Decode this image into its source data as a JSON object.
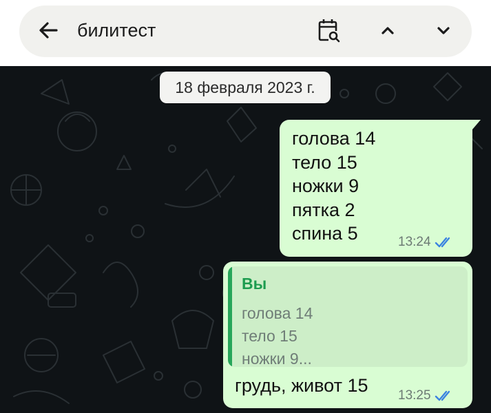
{
  "search": {
    "query": "билитест",
    "icons": [
      "arrow-left-icon",
      "calendar-search-icon",
      "chevron-up-icon",
      "chevron-down-icon"
    ]
  },
  "chat": {
    "date_label": "18 февраля 2023 г.",
    "messages": [
      {
        "lines": [
          "голова 14",
          "тело 15",
          "ножки 9",
          "пятка 2",
          "спина 5"
        ],
        "time": "13:24",
        "status": "read"
      },
      {
        "quote": {
          "author": "Вы",
          "lines": [
            "голова 14",
            "тело 15",
            "ножки 9..."
          ]
        },
        "text": "грудь, живот 15",
        "time": "13:25",
        "status": "read"
      }
    ]
  },
  "colors": {
    "chat_background": "#0f1316",
    "outgoing_bubble": "#d9fdd3",
    "quote_accent": "#27a65a",
    "read_ticks": "#3b83e0"
  }
}
